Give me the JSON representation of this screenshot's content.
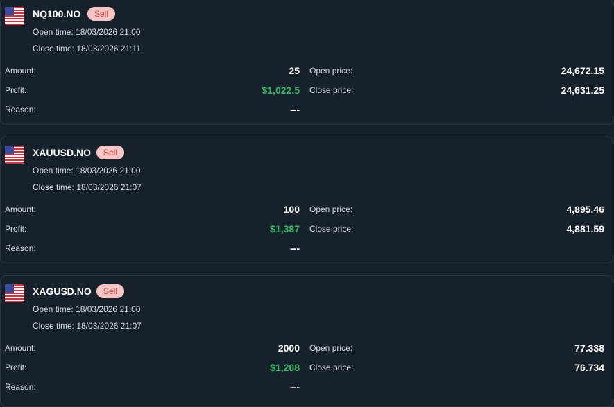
{
  "colors": {
    "background": "#17212b",
    "profit": "#2ebd6b",
    "sell_badge_bg": "#f7c6c4",
    "sell_badge_text": "#d2453e"
  },
  "labels": {
    "open_time": "Open time:",
    "close_time": "Close time:",
    "amount": "Amount:",
    "profit": "Profit:",
    "reason": "Reason:",
    "open_price": "Open price:",
    "close_price": "Close price:"
  },
  "trades": [
    {
      "flag_icon": "us-flag-icon",
      "symbol": "NQ100.NO",
      "side": "Sell",
      "open_time": "18/03/2026 21:00",
      "close_time": "18/03/2026 21:11",
      "amount": "25",
      "profit": "$1,022.5",
      "reason": "---",
      "open_price": "24,672.15",
      "close_price": "24,631.25"
    },
    {
      "flag_icon": "us-flag-icon",
      "symbol": "XAUUSD.NO",
      "side": "Sell",
      "open_time": "18/03/2026 21:00",
      "close_time": "18/03/2026 21:07",
      "amount": "100",
      "profit": "$1,387",
      "reason": "---",
      "open_price": "4,895.46",
      "close_price": "4,881.59"
    },
    {
      "flag_icon": "us-flag-icon",
      "symbol": "XAGUSD.NO",
      "side": "Sell",
      "open_time": "18/03/2026 21:00",
      "close_time": "18/03/2026 21:07",
      "amount": "2000",
      "profit": "$1,208",
      "reason": "---",
      "open_price": "77.338",
      "close_price": "76.734"
    }
  ]
}
